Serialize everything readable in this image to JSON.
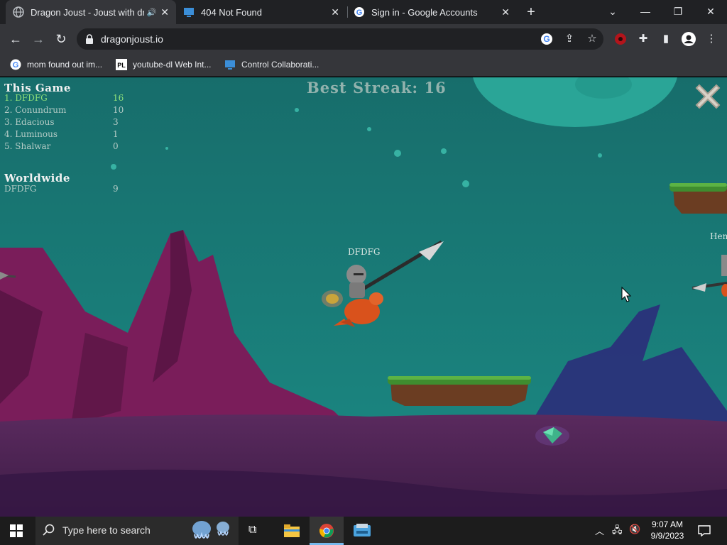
{
  "browser": {
    "tabs": [
      {
        "title": "Dragon Joust - Joust with dr",
        "active": true,
        "audio": true
      },
      {
        "title": "404 Not Found",
        "active": false
      },
      {
        "title": "Sign in - Google Accounts",
        "active": false
      }
    ],
    "url": "dragonjoust.io",
    "bookmarks": [
      {
        "label": "mom found out im..."
      },
      {
        "label": "youtube-dl Web Int..."
      },
      {
        "label": "Control Collaborati..."
      }
    ]
  },
  "game": {
    "best_streak": "Best Streak: 16",
    "this_game": {
      "heading": "This Game",
      "rows": [
        {
          "rank_name": "1. DFDFG",
          "score": "16",
          "is_player": true
        },
        {
          "rank_name": "2. Conundrum",
          "score": "10"
        },
        {
          "rank_name": "3. Edacious",
          "score": "3"
        },
        {
          "rank_name": "4. Luminous",
          "score": "1"
        },
        {
          "rank_name": "5. Shalwar",
          "score": "0"
        }
      ]
    },
    "worldwide": {
      "heading": "Worldwide",
      "rows": [
        {
          "rank_name": "DFDFG",
          "score": "9"
        }
      ]
    },
    "player_name": "DFDFG",
    "opponent_name": "Hen",
    "colors": {
      "sky": "#187a76",
      "mountain": "#7a1d5a",
      "ground": "#4a1f4e",
      "moon": "#2fae9a"
    }
  },
  "taskbar": {
    "search_placeholder": "Type here to search",
    "time": "9:07 AM",
    "date": "9/9/2023"
  }
}
